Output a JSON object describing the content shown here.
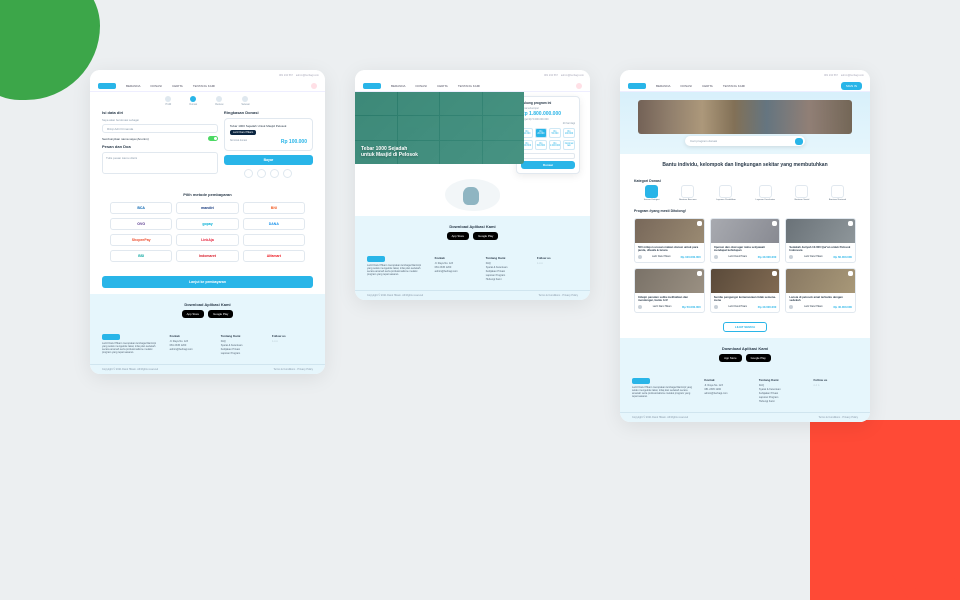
{
  "topbar": {
    "phone": "081 234 567",
    "email": "admin@berbagi.com"
  },
  "nav": {
    "items": [
      "BERANDA",
      "DONASI",
      "CERITA",
      "TENTANG KAMI"
    ],
    "signin": "SIGN IN"
  },
  "f1": {
    "steps": [
      "Profil",
      "Donasi",
      "Review",
      "Selesai"
    ],
    "left": {
      "title": "Isi data diri",
      "hint": "Saya akan berdonasi sebagai",
      "name": "Rizqi Adri Firmanda",
      "anon_label": "Sembunyikan nama saya (Anonim)",
      "doa_title": "Pesan dan Doa",
      "doa_ph": "Tulis pesan kamu disini"
    },
    "right": {
      "title": "Ringkasan Donasi",
      "program": "Tebar 1000 Sejadah Untuk Masjid Pelosok",
      "org": "Laziz Darul Hikam",
      "amount": "Rp 100.000",
      "cta": "Bayar"
    },
    "pay": {
      "title": "Pilih metode pembayaran",
      "items": [
        "BCA",
        "mandiri",
        "BNI",
        "OVO",
        "gopay",
        "DANA",
        "ShopeePay",
        "LinkAja",
        "BSI",
        "Indomaret",
        "Alfamart"
      ],
      "cta": "Lanjut ke pembayaran"
    }
  },
  "f2": {
    "hero": {
      "title1": "Tebar 1000 Sejadah",
      "title2": "untuk Masjid di Pelosok"
    },
    "card": {
      "title": "Dukung program ini",
      "collected_label": "Dana terkumpul",
      "collected": "Rp 1.800.000.000",
      "target": "Target Rp 5.000.000.000",
      "days": "20 hari lagi",
      "presets": [
        "Rp 10.000",
        "Rp 20.000",
        "Rp 50.000",
        "Rp 100.000",
        "Rp 200.000",
        "Rp 500.000",
        "Rp 1.000.000",
        "Nominal lain"
      ],
      "cta": "Donasi"
    }
  },
  "f3": {
    "headline": "Bantu individu, kelompok dan lingkungan sekitar yang membutuhkan",
    "search_ph": "Cari program donasi",
    "cat_title": "Kategori Donasi",
    "cats": [
      "Semua Kategori",
      "Bantuan Bencana",
      "Layanan Pendidikan",
      "Layanan Kesehatan",
      "Bantuan Sosial",
      "Bantuan Nasional"
    ],
    "sec": "Program #yang mesti Ditolong!",
    "cards": [
      {
        "title": "500 mitiqon urusan makan donasi untuk para janda, dhuafa & lansia",
        "org": "Laziz Darul Hikam",
        "amt": "Rp 100.000.000"
      },
      {
        "title": "Operasi dan obat agar ratna setiyawati mendapat kehidupan",
        "org": "Laziz Darul Hikam",
        "amt": "Rp 40.000.000"
      },
      {
        "title": "Sedekah Jariyah 10.000 Qur'an untuk Pelosok Indonesia",
        "org": "Laziz Darul Hikam",
        "amt": "Rp 60.000.000"
      },
      {
        "title": "Infaqin panutan sulita melihatkan dan mendengar, bantu Arif",
        "org": "Laziz Darul Hikam",
        "amt": "Rp 50.000.000"
      },
      {
        "title": "Sumbu pengungsi kemanusiaan tidak semena-mena",
        "org": "Laziz Darul Hikam",
        "amt": "Rp 40.000.000"
      },
      {
        "title": "Lansia di pelosok amat terbantu dengan sedekah",
        "org": "Laziz Darul Hikam",
        "amt": "Rp 40.000.000"
      }
    ],
    "more": "LIHAT SEMUA"
  },
  "dl": {
    "title": "Download Aplikasi Kami",
    "appstore": "App Store",
    "play": "Google Play"
  },
  "footer": {
    "about": "Laziz Darul Hikam merupakan lembaga filantropi yang selalu mengelola zakat, infaq dan sedekah secara amanah serta profesionalisme melalui program yang tepat sasaran.",
    "kontak": {
      "h": "Kontak",
      "addr": "Jl. Raya No. 123",
      "phone": "081 2345 1200",
      "email": "admin@berbagi.com"
    },
    "tentang": {
      "h": "Tentang Kami",
      "items": [
        "FAQ",
        "Syarat & Ketentuan",
        "Kebijakan Privasi",
        "Laporan Program",
        "Hubungi Kami"
      ]
    },
    "follow": {
      "h": "Follow us"
    },
    "copy": "Copyright © 2021 Darul Hikam. All Rights reserved",
    "links": "Terms & Conditions · Privacy Policy"
  }
}
